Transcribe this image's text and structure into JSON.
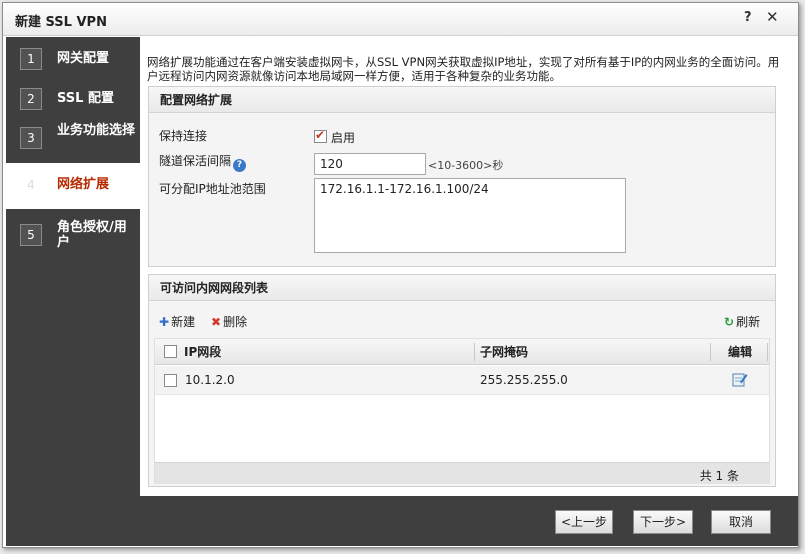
{
  "window": {
    "title": "新建 SSL VPN",
    "help": "?",
    "close": "✕"
  },
  "steps": [
    {
      "num": "1",
      "label": "网关配置"
    },
    {
      "num": "2",
      "label": "SSL 配置"
    },
    {
      "num": "3",
      "label": "业务功能选择"
    },
    {
      "num": "4",
      "label": "网络扩展"
    },
    {
      "num": "5",
      "label": "角色授权/用户"
    }
  ],
  "intro": "网络扩展功能通过在客户端安装虚拟网卡，从SSL VPN网关获取虚拟IP地址，实现了对所有基于IP的内网业务的全面访问。用户远程访问内网资源就像访问本地局域网一样方便，适用于各种复杂的业务功能。",
  "config": {
    "heading": "配置网络扩展",
    "keepalive_label": "保持连接",
    "keepalive_enabled_label": "启用",
    "interval_label": "隧道保活间隔",
    "interval_value": "120",
    "interval_hint": "<10-3600>秒",
    "pool_label": "可分配IP地址池范围",
    "pool_value": "172.16.1.1-172.16.1.100/24"
  },
  "subnets": {
    "heading": "可访问内网网段列表",
    "new_label": "新建",
    "delete_label": "删除",
    "refresh_label": "刷新",
    "columns": {
      "ip": "IP网段",
      "mask": "子网掩码",
      "edit": "编辑"
    },
    "rows": [
      {
        "ip": "10.1.2.0",
        "mask": "255.255.255.0"
      }
    ],
    "total": "共 1 条"
  },
  "footer": {
    "prev": "<上一步",
    "next": "下一步>",
    "cancel": "取消"
  }
}
